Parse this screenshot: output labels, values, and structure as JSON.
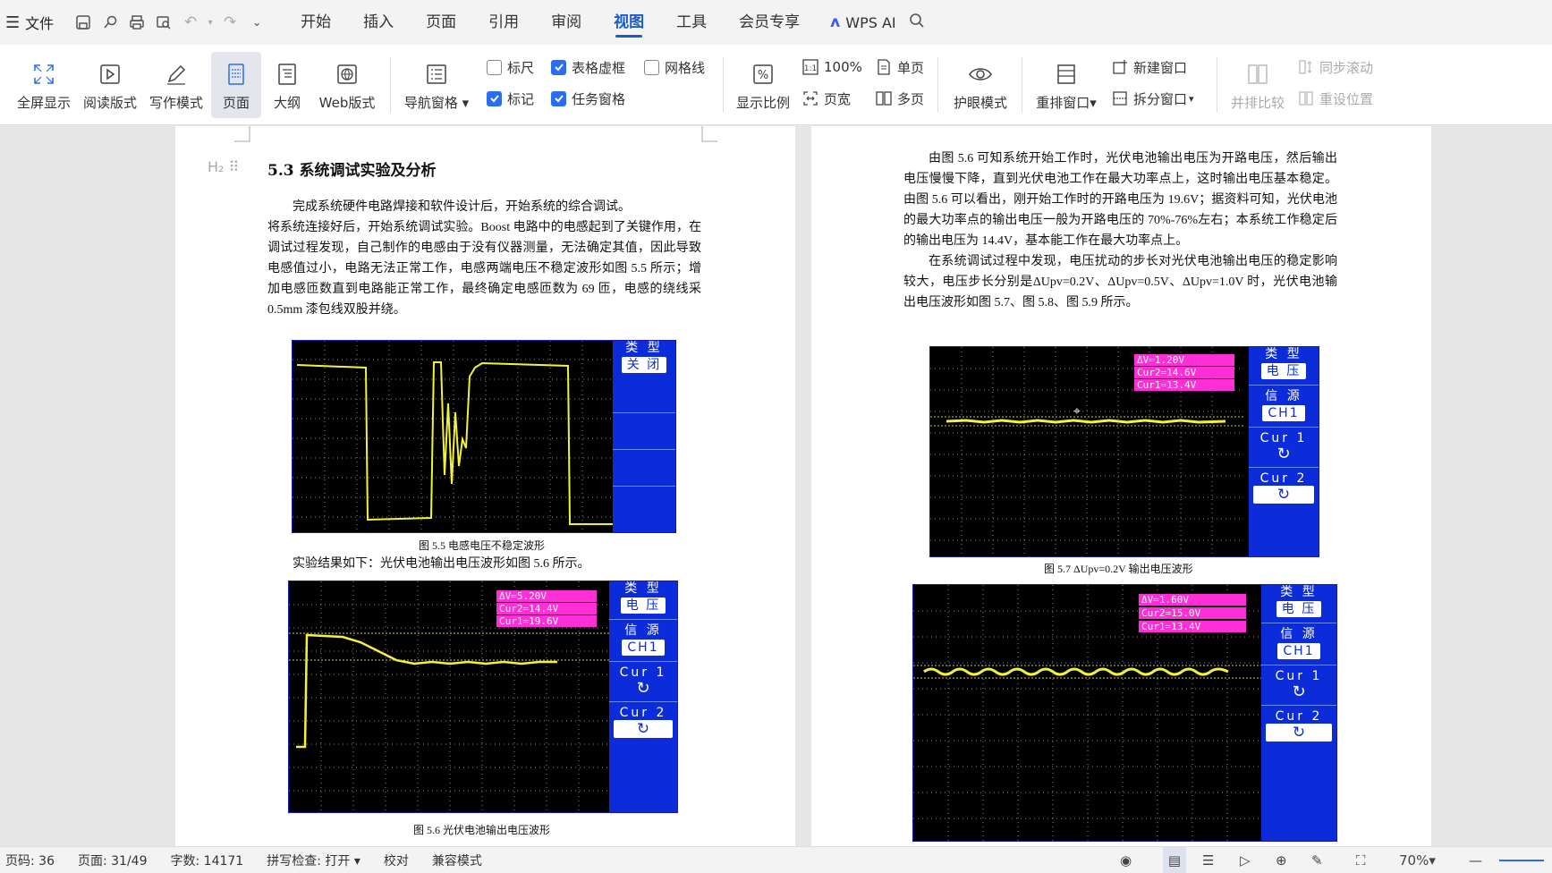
{
  "topbar": {
    "file_label": "文件",
    "tabs": [
      "开始",
      "插入",
      "页面",
      "引用",
      "审阅",
      "视图",
      "工具",
      "会员专享"
    ],
    "active_tab": "视图",
    "wps_ai": "WPS AI"
  },
  "ribbon": {
    "fullscreen": "全屏显示",
    "reading": "阅读版式",
    "writing": "写作模式",
    "page": "页面",
    "outline": "大纲",
    "web": "Web版式",
    "navpane": "导航窗格",
    "ruler": "标尺",
    "table_grid": "表格虚框",
    "gridlines": "网格线",
    "mark": "标记",
    "task_pane": "任务窗格",
    "zoom_ratio": "显示比例",
    "zoom100": "100%",
    "page_width": "页宽",
    "single_page": "单页",
    "multi_page": "多页",
    "eye_mode": "护眼模式",
    "rearrange": "重排窗口",
    "new_window": "新建窗口",
    "split_window": "拆分窗口",
    "side_by_side": "并排比较",
    "sync_scroll": "同步滚动",
    "reset_pos": "重设位置"
  },
  "doc": {
    "left": {
      "heading": "5.3  系统调试实验及分析",
      "para1": "完成系统硬件电路焊接和软件设计后，开始系统的综合调试。",
      "para2": "将系统连接好后，开始系统调试实验。Boost 电路中的电感起到了关键作用，在调试过程发现，自己制作的电感由于没有仪器测量，无法确定其值，因此导致电感值过小，电路无法正常工作，电感两端电压不稳定波形如图 5.5 所示；增加电感匝数直到电路能正常工作，最终确定电感匝数为 69 匝，电感的绕线采 0.5mm 漆包线双股并绕。",
      "fig55_caption": "图 5.5  电感电压不稳定波形",
      "para3": "实验结果如下：光伏电池输出电压波形如图 5.6 所示。",
      "fig56_caption": "图 5.6  光伏电池输出电压波形"
    },
    "right": {
      "para1": "由图 5.6 可知系统开始工作时，光伏电池输出电压为开路电压，然后输出电压慢慢下降，直到光伏电池工作在最大功率点上，这时输出电压基本稳定。由图 5.6 可以看出，刚开始工作时的开路电压为 19.6V；据资料可知，光伏电池的最大功率点的输出电压一般为开路电压的 70%-76%左右；本系统工作稳定后的输出电压为 14.4V，基本能工作在最大功率点上。",
      "para2": "在系统调试过程中发现，电压扰动的步长对光伏电池输出电压的稳定影响较大，电压步长分别是ΔUpv=0.2V、ΔUpv=0.5V、ΔUpv=1.0V 时，光伏电池输出电压波形如图 5.7、图 5.8、图 5.9 所示。",
      "fig57_caption": "图 5.7 ΔUpv=0.2V 输出电压波形"
    },
    "scope": {
      "type": "类 型",
      "off": "关 闭",
      "voltage": "电 压",
      "source": "信 源",
      "ch1": "CH1",
      "cur1": "Cur 1",
      "cur2": "Cur 2",
      "fig56": {
        "dv": "ΔV=5.20V",
        "cur2": "Cur2=14.4V",
        "cur1": "Cur1=19.6V"
      },
      "fig57": {
        "dv": "ΔV=1.20V",
        "cur2": "Cur2=14.6V",
        "cur1": "Cur1=13.4V"
      },
      "fig58": {
        "dv": "ΔV=1.60V",
        "cur2": "Cur2=15.0V",
        "cur1": "Cur1=13.4V"
      }
    }
  },
  "status": {
    "page_code": "页码: 36",
    "page": "页面: 31/49",
    "words": "字数: 14171",
    "spell": "拼写检查: 打开",
    "proof": "校对",
    "compat": "兼容模式",
    "zoom": "70%"
  }
}
